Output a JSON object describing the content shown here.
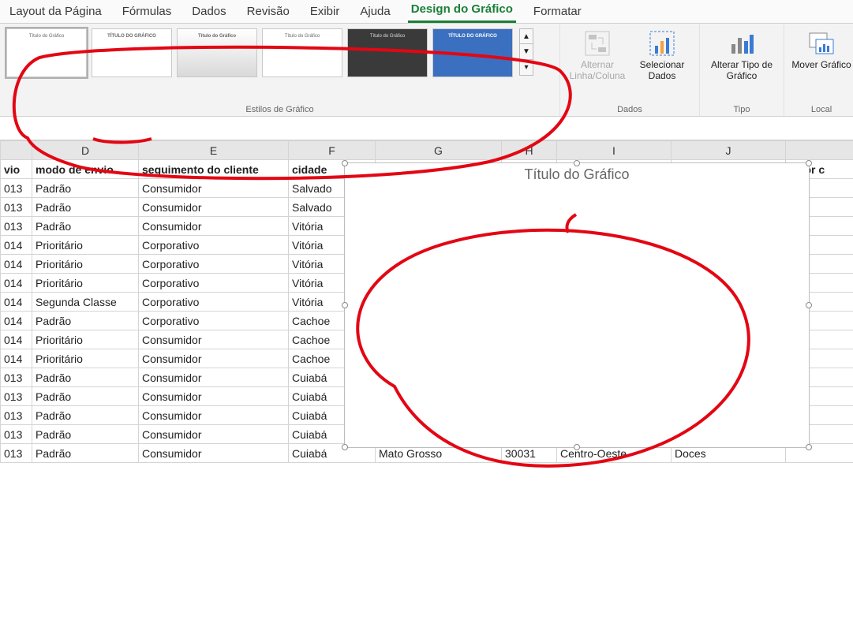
{
  "tabs": {
    "layout": "Layout da Página",
    "formulas": "Fórmulas",
    "dados": "Dados",
    "revisao": "Revisão",
    "exibir": "Exibir",
    "ajuda": "Ajuda",
    "design": "Design do Gráfico",
    "formatar": "Formatar"
  },
  "ribbon": {
    "styles_group_label": "Estilos de Gráfico",
    "thumb_titles": [
      "Título do Gráfico",
      "TÍTULO DO GRÁFICO",
      "Título do Gráfico",
      "Título do Gráfico",
      "Título do Gráfico",
      "TÍTULO DO GRÁFICO"
    ],
    "dados_group_label": "Dados",
    "alternar_label": "Alternar Linha/Coluna",
    "selecionar_label": "Selecionar Dados",
    "tipo_group_label": "Tipo",
    "alterar_tipo_label": "Alterar Tipo de Gráfico",
    "local_group_label": "Local",
    "mover_label": "Mover Gráfico"
  },
  "columns": {
    "D": "D",
    "E": "E",
    "F": "F",
    "G": "G",
    "H": "H",
    "I": "I",
    "J": "J"
  },
  "headers": {
    "c_tail": "vio",
    "d": "modo de envio",
    "e": "seguimento do cliente",
    "f": "cidade",
    "k": "valor c"
  },
  "rows": [
    {
      "c": "013",
      "d": "Padrão",
      "e": "Consumidor",
      "f": "Salvado"
    },
    {
      "c": "013",
      "d": "Padrão",
      "e": "Consumidor",
      "f": "Salvado"
    },
    {
      "c": "013",
      "d": "Padrão",
      "e": "Consumidor",
      "f": "Vitória"
    },
    {
      "c": "014",
      "d": "Prioritário",
      "e": "Corporativo",
      "f": "Vitória"
    },
    {
      "c": "014",
      "d": "Prioritário",
      "e": "Corporativo",
      "f": "Vitória"
    },
    {
      "c": "014",
      "d": "Prioritário",
      "e": "Corporativo",
      "f": "Vitória"
    },
    {
      "c": "014",
      "d": "Segunda Classe",
      "e": "Corporativo",
      "f": "Vitória"
    },
    {
      "c": "014",
      "d": "Padrão",
      "e": "Corporativo",
      "f": "Cachoe"
    },
    {
      "c": "014",
      "d": "Prioritário",
      "e": "Consumidor",
      "f": "Cachoe"
    },
    {
      "c": "014",
      "d": "Prioritário",
      "e": "Consumidor",
      "f": "Cachoe"
    },
    {
      "c": "013",
      "d": "Padrão",
      "e": "Consumidor",
      "f": "Cuiabá"
    },
    {
      "c": "013",
      "d": "Padrão",
      "e": "Consumidor",
      "f": "Cuiabá"
    },
    {
      "c": "013",
      "d": "Padrão",
      "e": "Consumidor",
      "f": "Cuiabá"
    },
    {
      "c": "013",
      "d": "Padrão",
      "e": "Consumidor",
      "f": "Cuiabá"
    },
    {
      "c": "013",
      "d": "Padrão",
      "e": "Consumidor",
      "f": "Cuiabá",
      "g": "Mato Grosso",
      "h": "30031",
      "i": "Centro-Oeste",
      "j": "Doces"
    }
  ],
  "chart": {
    "title": "Título do Gráfico"
  },
  "chart_data": {
    "type": "bar",
    "title": "Título do Gráfico",
    "categories": [],
    "values": [],
    "xlabel": "",
    "ylabel": "",
    "note": "empty chart placeholder – no data series plotted"
  }
}
